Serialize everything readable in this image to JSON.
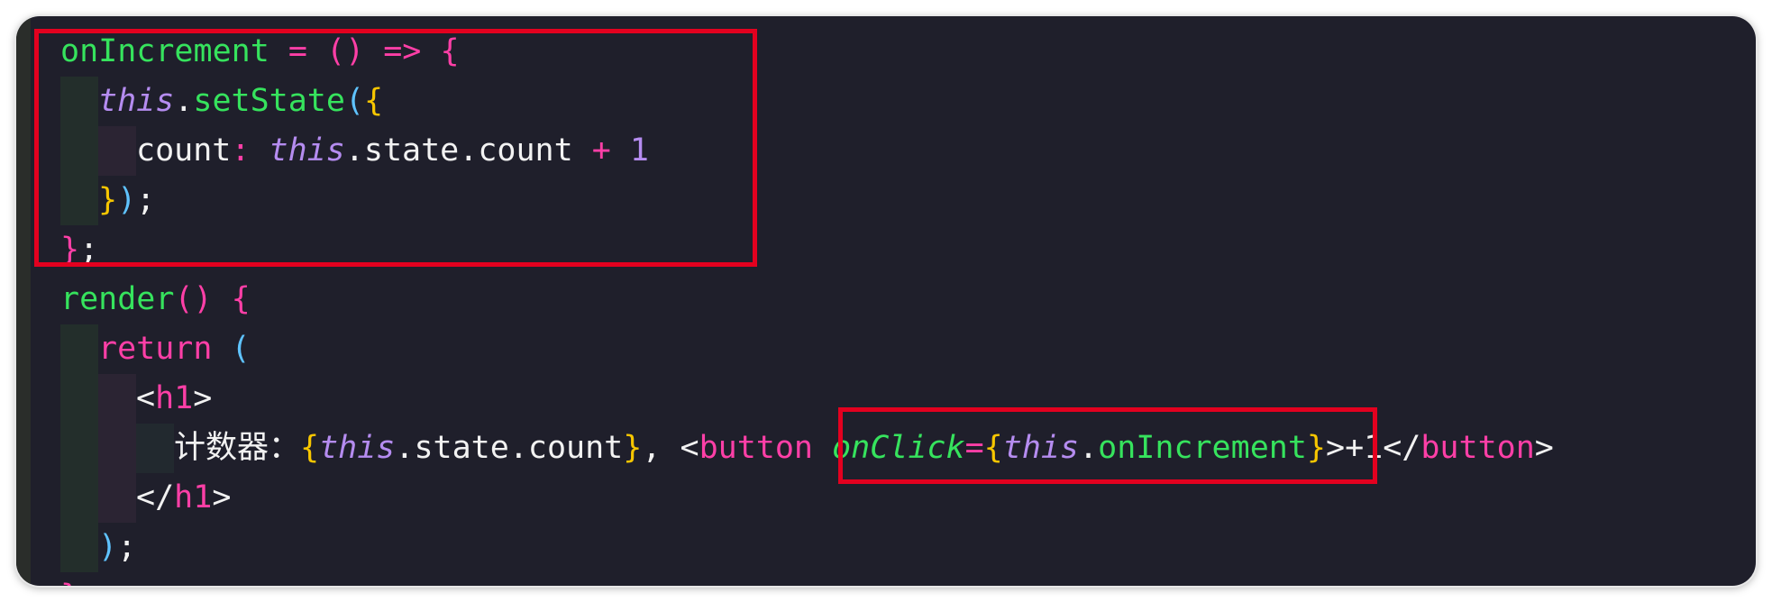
{
  "code_lines": [
    {
      "tokens": [
        "onIncrement",
        " = () => {"
      ]
    },
    {
      "tokens": [
        "this",
        ".",
        "setState",
        "(",
        "{"
      ]
    },
    {
      "tokens": [
        "count",
        ": ",
        "this",
        ".state.count ",
        "+",
        " 1"
      ]
    },
    {
      "tokens": [
        "}",
        ")",
        ";"
      ]
    },
    {
      "tokens": [
        "}",
        ";"
      ]
    },
    {
      "tokens": [
        "render",
        "() {"
      ]
    },
    {
      "tokens": [
        "return",
        " ("
      ]
    },
    {
      "tokens": [
        "<",
        "h1",
        ">"
      ]
    },
    {
      "tokens": [
        "计数器：",
        "{",
        "this",
        ".state.count",
        "}",
        ", <",
        "button",
        " ",
        "onClick",
        "=",
        "{",
        "this",
        ".",
        "onIncrement",
        "}",
        ">+1</",
        "button",
        ">"
      ]
    },
    {
      "tokens": [
        "</",
        "h1",
        ">"
      ]
    },
    {
      "tokens": [
        ")",
        ";"
      ]
    },
    {
      "tokens": [
        "}"
      ]
    }
  ],
  "colors": {
    "background": "#1f1f2b",
    "identifier_green": "#36e35d",
    "keyword_pink": "#ff3fa7",
    "this_purple": "#b58cf0",
    "brace_yellow": "#f7c600",
    "paren_blue": "#5fc3ff",
    "highlight_red": "#e3001f"
  }
}
